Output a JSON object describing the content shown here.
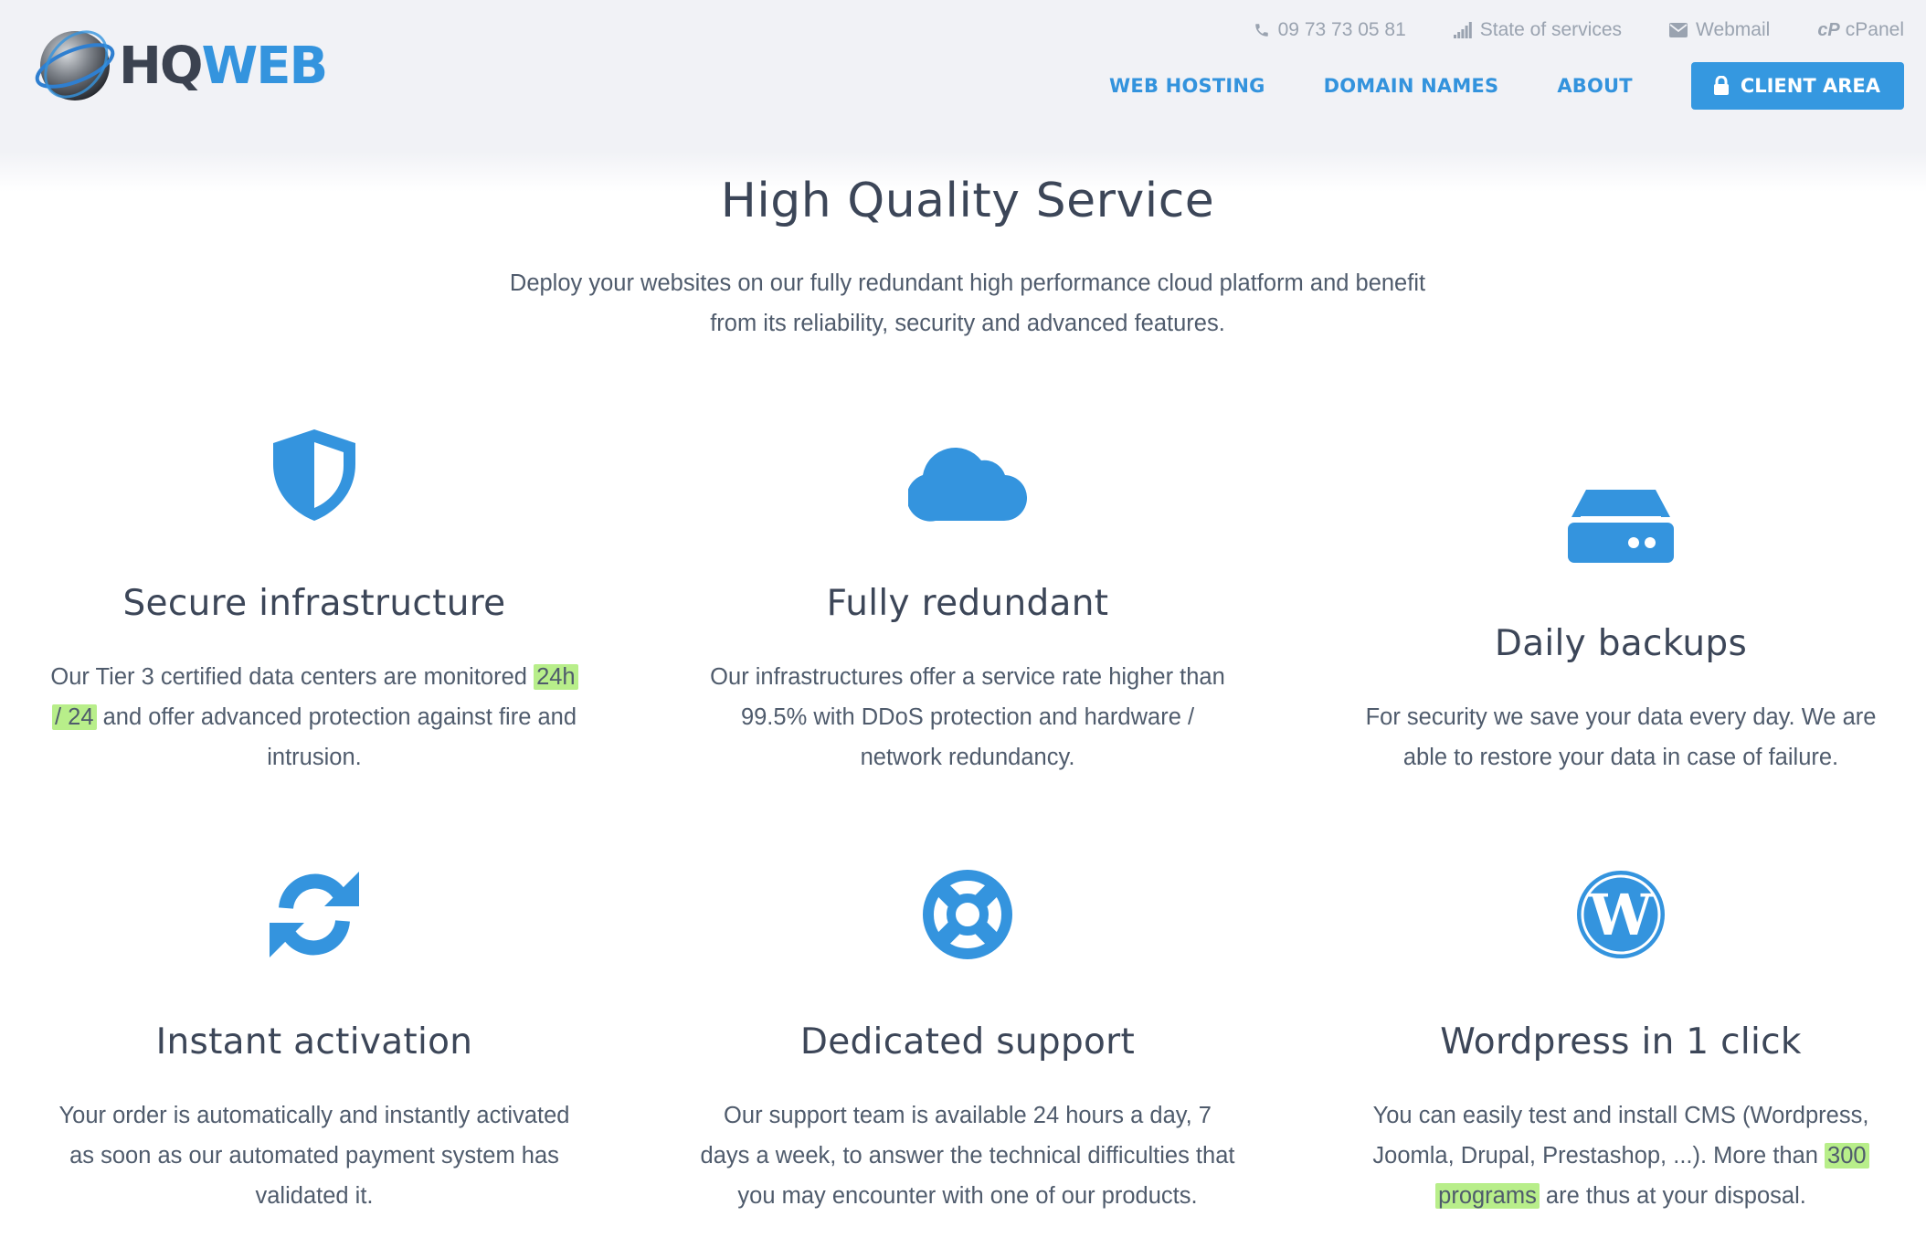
{
  "brand": {
    "part1": "HQ",
    "part2": "WEB",
    "accent": "#3494de"
  },
  "utility": {
    "phone": {
      "icon": "phone-icon",
      "label": "09 73 73 05 81"
    },
    "status": {
      "icon": "signal-icon",
      "label": "State of services"
    },
    "webmail": {
      "icon": "envelope-icon",
      "label": "Webmail"
    },
    "cpanel": {
      "icon": "cpanel-icon",
      "glyph": "cP",
      "label": "cPanel"
    }
  },
  "nav": {
    "hosting": "WEB HOSTING",
    "domains": "DOMAIN NAMES",
    "about": "ABOUT",
    "client": {
      "icon": "lock-icon",
      "label": "CLIENT AREA"
    }
  },
  "hero": {
    "title": "High Quality Service",
    "subtitle_line1": "Deploy your websites on our fully redundant high performance cloud platform and benefit",
    "subtitle_line2": "from its reliability, security and advanced features."
  },
  "features": [
    {
      "icon": "shield-icon",
      "title": "Secure infrastructure",
      "text_l1a": "Our Tier 3 certified data centers are monitored ",
      "text_hl_a": "24h",
      "text_hl_b": "/ 24",
      "text_l2": " and offer advanced protection against fire and",
      "text_l3": "intrusion."
    },
    {
      "icon": "cloud-icon",
      "title": "Fully redundant",
      "text_l1": "Our infrastructures offer a service rate higher than",
      "text_l2": "99.5% with DDoS protection and hardware /",
      "text_l3": "network redundancy."
    },
    {
      "icon": "hard-drive-icon",
      "title": "Daily backups",
      "text_l1": "For security we save your data every day. We are",
      "text_l2": "able to restore your data in case of failure."
    },
    {
      "icon": "refresh-icon",
      "title": "Instant activation",
      "text_l1": "Your order is automatically and instantly activated",
      "text_l2": "as soon as our automated payment system has",
      "text_l3": "validated it."
    },
    {
      "icon": "life-ring-icon",
      "title": "Dedicated support",
      "text_l1": "Our support team is available 24 hours a day, 7",
      "text_l2": "days a week, to answer the technical difficulties that",
      "text_l3": "you may encounter with one of our products."
    },
    {
      "icon": "wordpress-icon",
      "title": "Wordpress in 1 click",
      "text_l1": "You can easily test and install CMS (Wordpress,",
      "text_l2a": "Joomla, Drupal, Prestashop, ...). More than ",
      "text_hl_a": "300",
      "text_hl_b": "programs",
      "text_l3": " are thus at your disposal."
    }
  ],
  "colors": {
    "icon_blue": "#3494de",
    "highlight": "#b8ee8a",
    "header_bg": "#f1f2f6",
    "text": "#4f5b6c"
  }
}
